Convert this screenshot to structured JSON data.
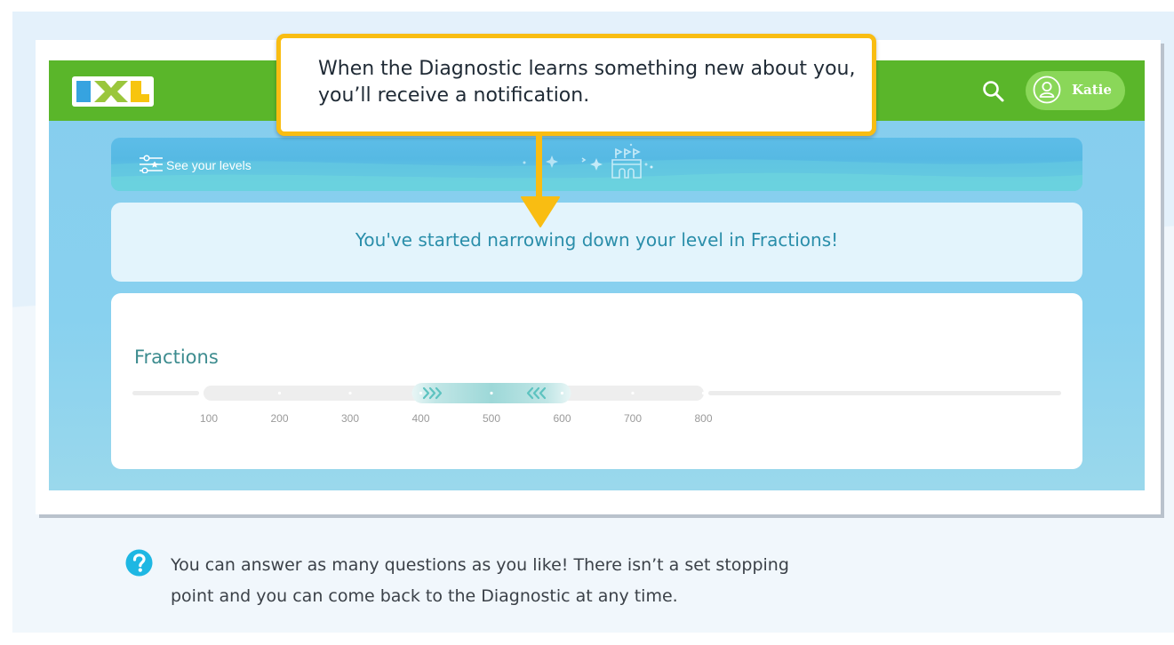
{
  "app": {
    "logo_text": "IXL",
    "user": {
      "name": "Katie"
    }
  },
  "levels_banner": {
    "label": "See your levels"
  },
  "notice": {
    "message": "You've started narrowing down your level in Fractions!"
  },
  "fractions": {
    "title": "Fractions",
    "scale_ticks": [
      "100",
      "200",
      "300",
      "400",
      "500",
      "600",
      "700",
      "800"
    ],
    "estimated_range": {
      "low": 400,
      "high": 600
    }
  },
  "callout": {
    "text": "When the Diagnostic learns something new about you, you’ll receive a notification."
  },
  "help": {
    "text": "You can answer as many questions as you like! There isn’t a set stopping point and you can come back to the Diagnostic at any time."
  },
  "colors": {
    "brand_green": "#5ab62a",
    "callout_border": "#f9bd12",
    "notice_text": "#2a8eaa"
  },
  "icons": [
    "ixl-logo",
    "search-icon",
    "user-avatar-icon",
    "sliders-icon",
    "castle-icon",
    "down-arrow-icon",
    "help-question-icon"
  ]
}
